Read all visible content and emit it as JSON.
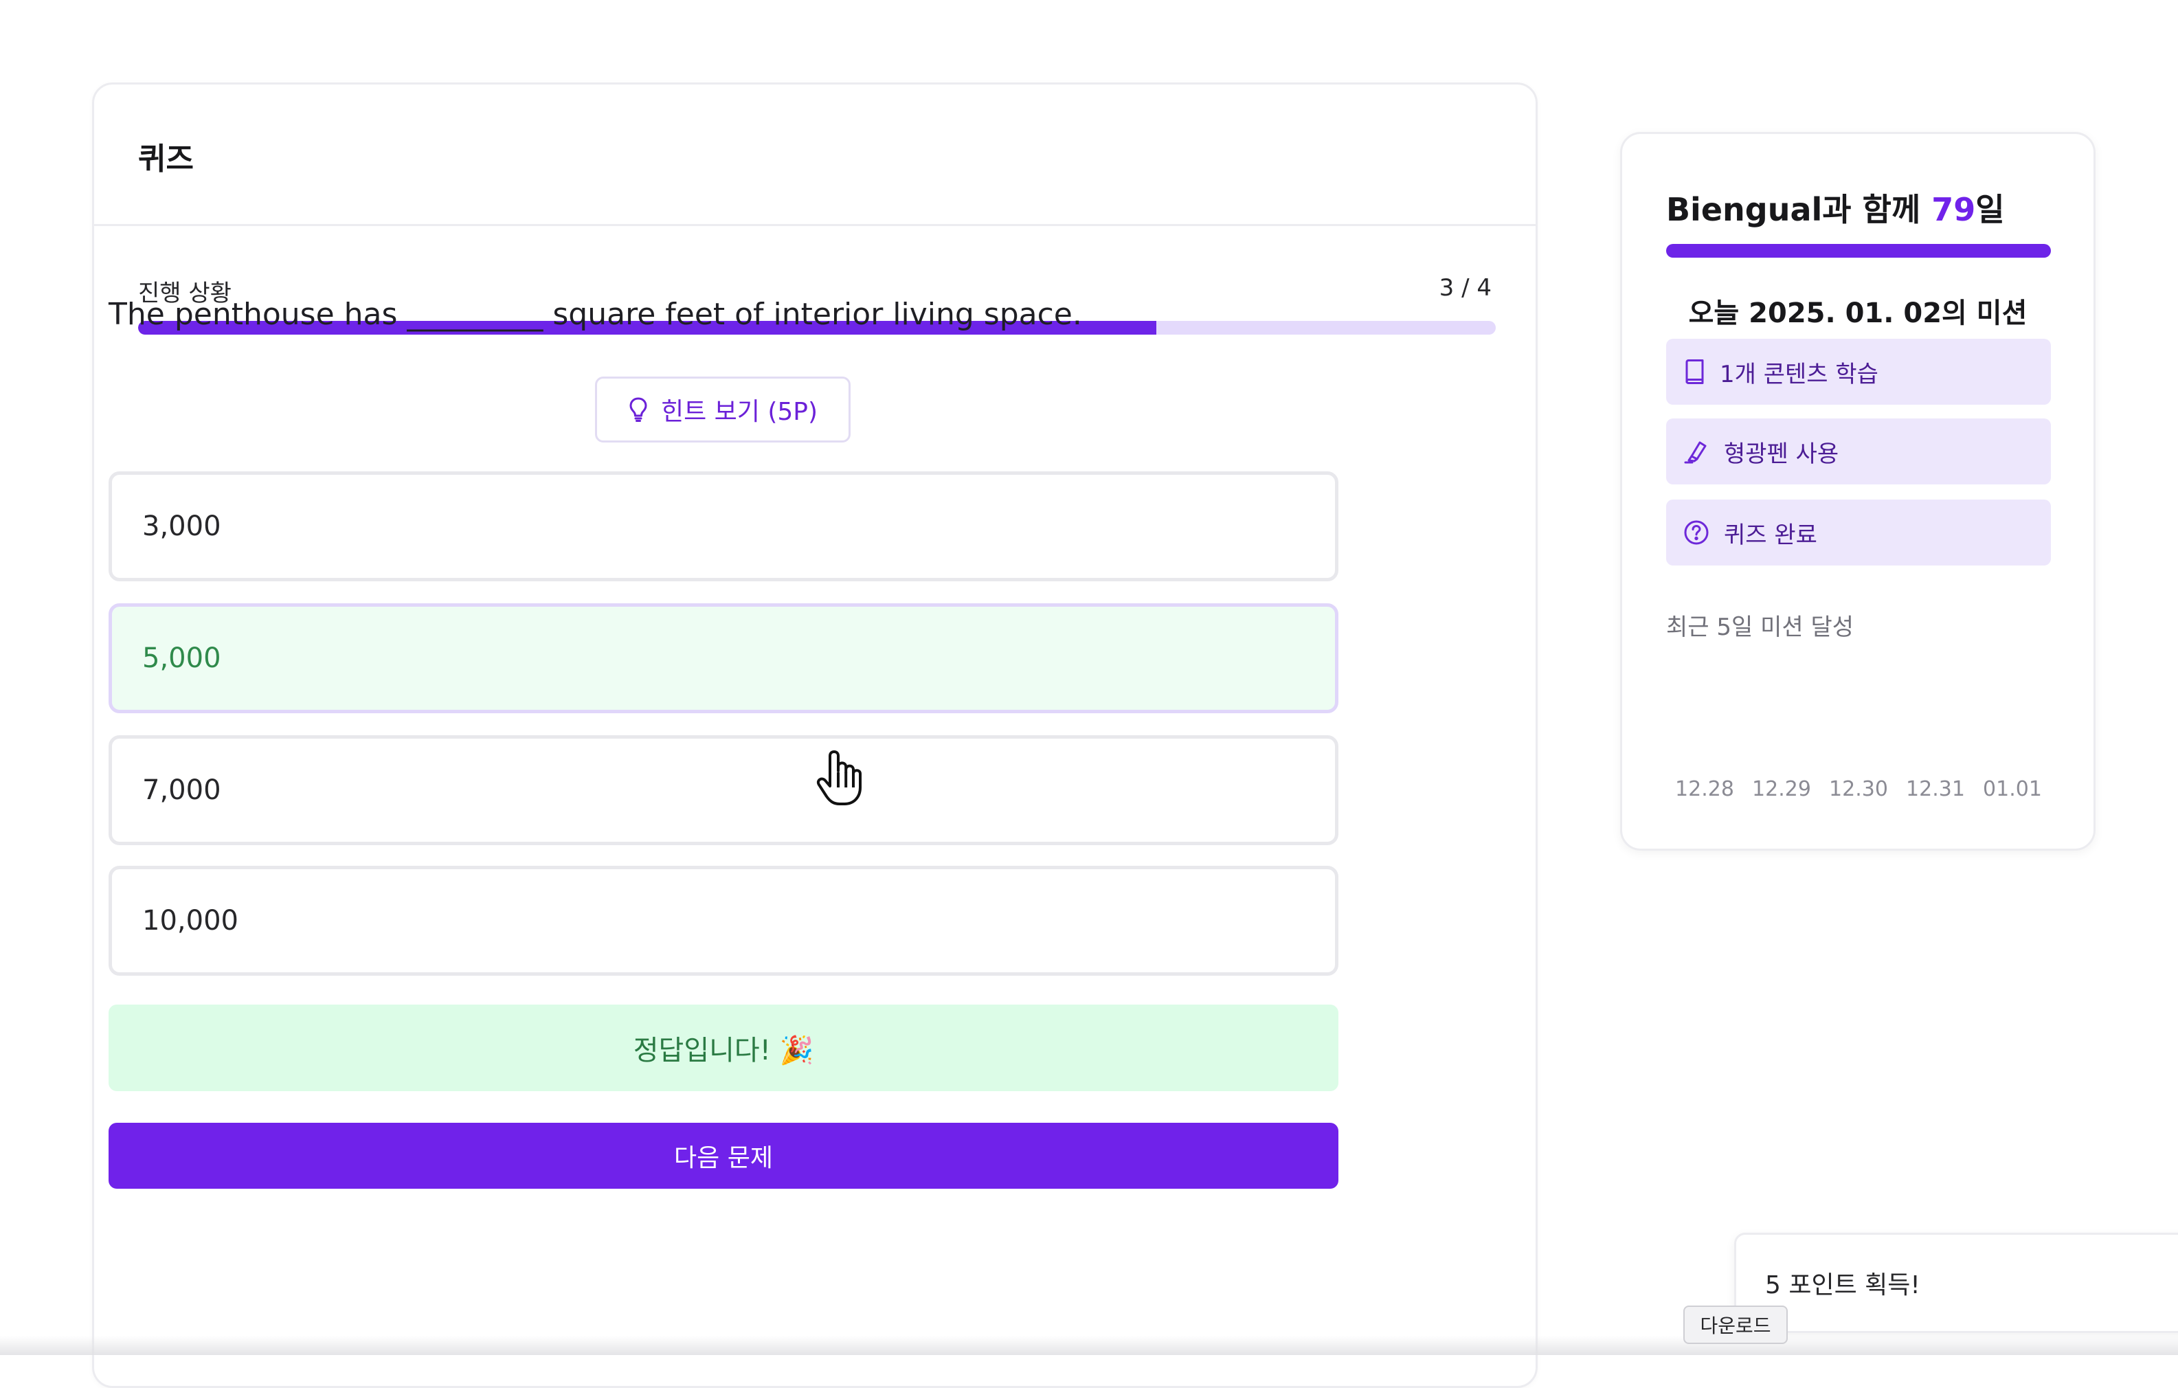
{
  "quiz": {
    "title": "퀴즈",
    "progress": {
      "label": "진행 상황",
      "count_text": "3 / 4",
      "current": 3,
      "total": 4,
      "fraction": 0.75
    },
    "question": "The penthouse has _________ square feet of interior living space.",
    "hint_button": {
      "label": "힌트 보기 (5P)",
      "icon": "lightbulb-icon"
    },
    "options": [
      {
        "label": "3,000",
        "state": "default"
      },
      {
        "label": "5,000",
        "state": "correct"
      },
      {
        "label": "7,000",
        "state": "default"
      },
      {
        "label": "10,000",
        "state": "default"
      }
    ],
    "feedback": "정답입니다! 🎉",
    "next_button": "다음 문제"
  },
  "mission_panel": {
    "streak_prefix": "Biengual과 함께 ",
    "streak_days": "79",
    "streak_suffix": "일",
    "today_mission": "오늘 2025. 01. 02의 미션",
    "missions": [
      {
        "label": "1개 콘텐츠 학습",
        "icon": "book-icon"
      },
      {
        "label": "형광펜 사용",
        "icon": "highlighter-icon"
      },
      {
        "label": "퀴즈 완료",
        "icon": "question-circle-icon"
      }
    ],
    "recent_label": "최근 5일 미션 달성",
    "recent_dates": [
      "12.28",
      "12.29",
      "12.30",
      "12.31",
      "01.01"
    ]
  },
  "toast": {
    "message": "5 포인트 획득!"
  },
  "tooltip": {
    "label": "다운로드"
  },
  "colors": {
    "accent": "#7022ea",
    "progress_track": "#e4dafc",
    "correct_bg": "#eefdf3",
    "correct_text": "#2f8a4b",
    "feedback_bg": "#dcfce7",
    "mission_bg": "#ede7fc"
  }
}
